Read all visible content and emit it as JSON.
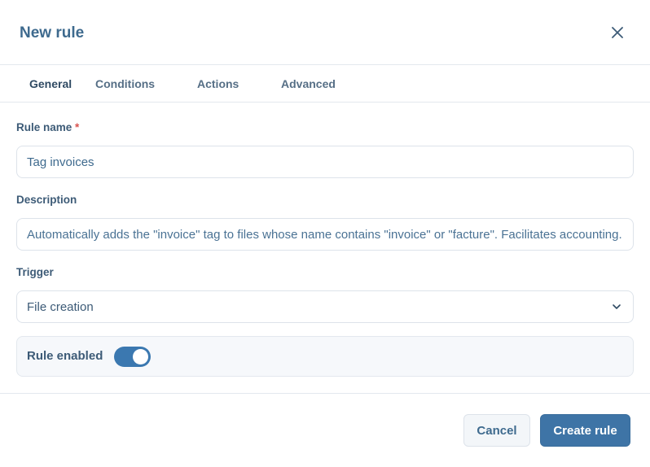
{
  "dialog": {
    "title": "New rule",
    "close_icon": "close-icon"
  },
  "tabs": [
    {
      "label": "General",
      "active": true
    },
    {
      "label": "Conditions",
      "active": false
    },
    {
      "label": "Actions",
      "active": false
    },
    {
      "label": "Advanced",
      "active": false
    }
  ],
  "form": {
    "rule_name": {
      "label": "Rule name",
      "required_mark": "*",
      "value": "Tag invoices"
    },
    "description": {
      "label": "Description",
      "value": "Automatically adds the \"invoice\" tag to files whose name contains \"invoice\" or \"facture\". Facilitates accounting."
    },
    "trigger": {
      "label": "Trigger",
      "selected": "File creation",
      "chevron_icon": "chevron-down-icon"
    },
    "enabled": {
      "label": "Rule enabled",
      "on": true
    }
  },
  "footer": {
    "cancel_label": "Cancel",
    "create_label": "Create rule"
  },
  "colors": {
    "accent": "#3e74a6",
    "toggle_on": "#3b78b0",
    "required": "#d9534f"
  }
}
